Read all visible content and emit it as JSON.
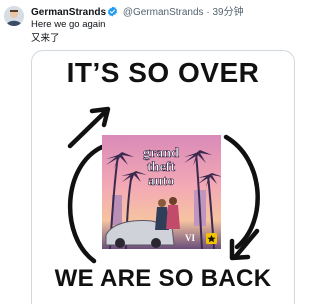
{
  "post": {
    "author_name": "GermanStrands",
    "handle": "@GermanStrands",
    "separator": "·",
    "time": "39分钟",
    "text_en": "Here we go again",
    "text_zh": "又来了"
  },
  "meme": {
    "top_text": "IT’S SO OVER",
    "bottom_text": "WE ARE SO BACK"
  },
  "poster": {
    "logo_line1": "grand",
    "logo_line2": "theft",
    "logo_line3": "auto",
    "numeral": "VI"
  },
  "colors": {
    "verified": "#1d9bf0",
    "text": "#0f1419",
    "muted": "#536471",
    "border": "#cfd9de"
  },
  "icons": [
    "verified-badge-icon",
    "cycle-arrow-icon",
    "rockstar-logo-icon"
  ]
}
